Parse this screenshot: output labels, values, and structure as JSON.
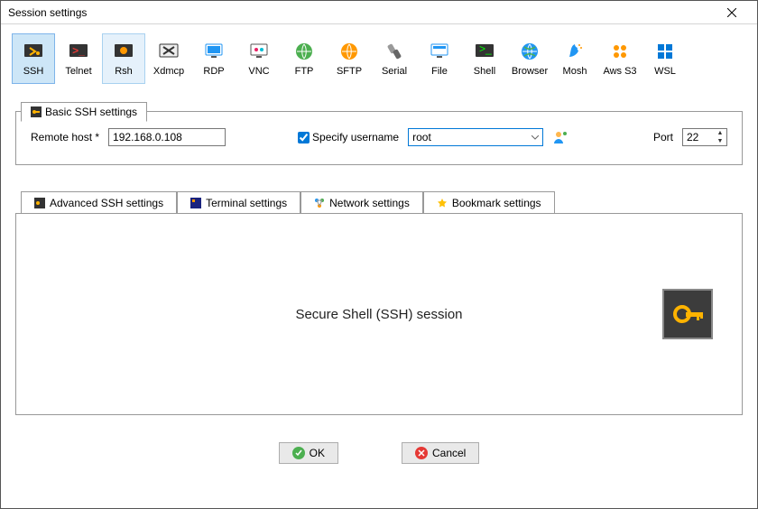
{
  "title": "Session settings",
  "session_types": [
    {
      "id": "ssh",
      "label": "SSH",
      "selected": true
    },
    {
      "id": "telnet",
      "label": "Telnet"
    },
    {
      "id": "rsh",
      "label": "Rsh",
      "hover": true
    },
    {
      "id": "xdmcp",
      "label": "Xdmcp"
    },
    {
      "id": "rdp",
      "label": "RDP"
    },
    {
      "id": "vnc",
      "label": "VNC"
    },
    {
      "id": "ftp",
      "label": "FTP"
    },
    {
      "id": "sftp",
      "label": "SFTP"
    },
    {
      "id": "serial",
      "label": "Serial"
    },
    {
      "id": "file",
      "label": "File"
    },
    {
      "id": "shell",
      "label": "Shell"
    },
    {
      "id": "browser",
      "label": "Browser"
    },
    {
      "id": "mosh",
      "label": "Mosh"
    },
    {
      "id": "awss3",
      "label": "Aws S3"
    },
    {
      "id": "wsl",
      "label": "WSL"
    }
  ],
  "basic_tab": {
    "title": "Basic SSH settings",
    "remote_host_label": "Remote host *",
    "remote_host_value": "192.168.0.108",
    "specify_username_label": "Specify username",
    "specify_username_checked": true,
    "username_value": "root",
    "port_label": "Port",
    "port_value": "22"
  },
  "sub_tabs": {
    "advanced": "Advanced SSH settings",
    "terminal": "Terminal settings",
    "network": "Network settings",
    "bookmark": "Bookmark settings"
  },
  "session_description": "Secure Shell (SSH) session",
  "buttons": {
    "ok": "OK",
    "cancel": "Cancel"
  }
}
